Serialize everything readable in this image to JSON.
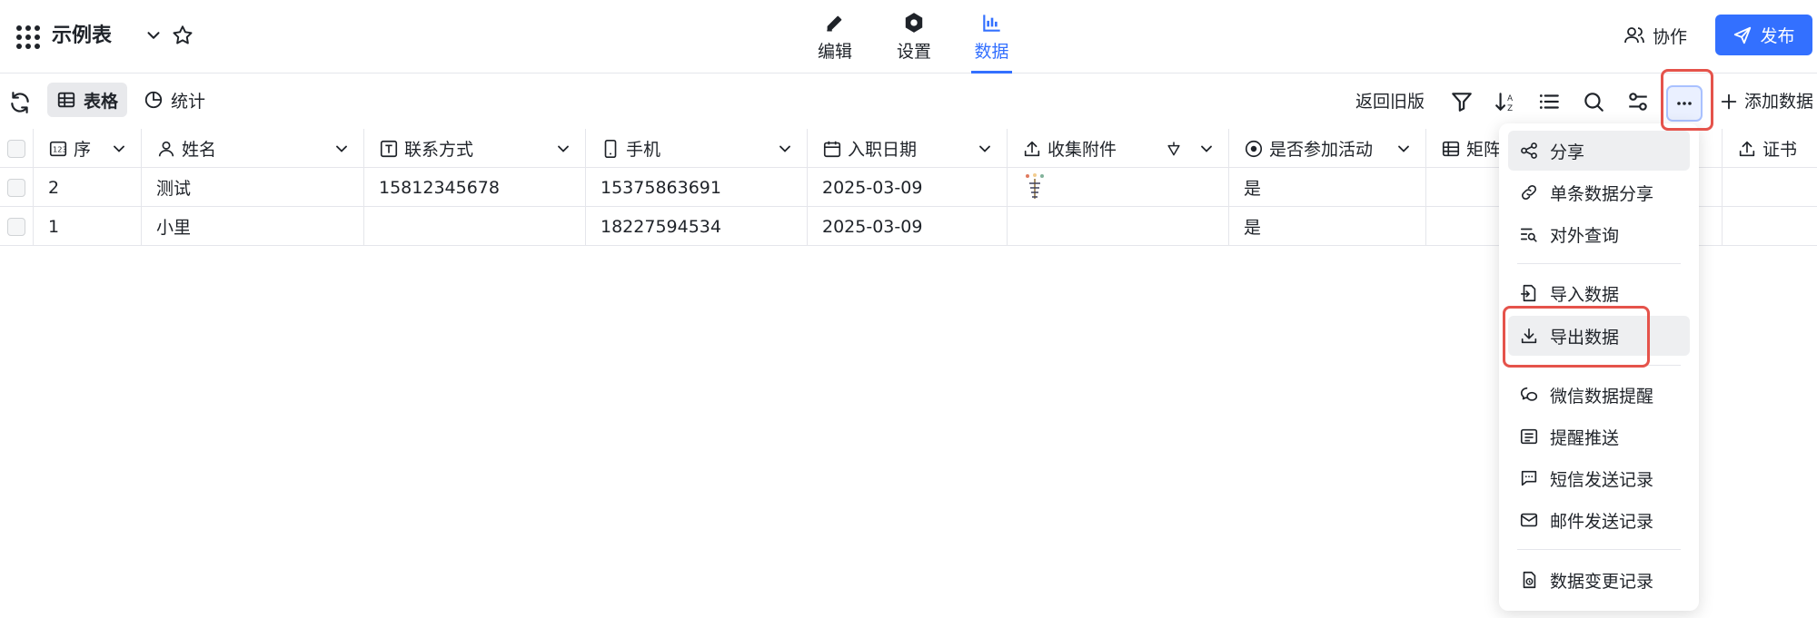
{
  "header": {
    "title": "示例表",
    "tabs": [
      {
        "label": "编辑",
        "icon": "pen-icon"
      },
      {
        "label": "设置",
        "icon": "hexagon-settings-icon"
      },
      {
        "label": "数据",
        "icon": "bar-chart-icon"
      }
    ],
    "active_tab": "数据",
    "collab_label": "协作",
    "publish_label": "发布"
  },
  "toolbar": {
    "views": [
      {
        "label": "表格",
        "icon": "table-icon"
      },
      {
        "label": "统计",
        "icon": "pie-chart-icon"
      }
    ],
    "old_version_label": "返回旧版",
    "add_data_label": "添加数据"
  },
  "table": {
    "columns": [
      {
        "label": "序",
        "icon": "number-icon"
      },
      {
        "label": "姓名",
        "icon": "person-icon"
      },
      {
        "label": "联系方式",
        "icon": "text-field-icon"
      },
      {
        "label": "手机",
        "icon": "phone-icon"
      },
      {
        "label": "入职日期",
        "icon": "calendar-icon"
      },
      {
        "label": "收集附件",
        "icon": "upload-icon"
      },
      {
        "label": "是否参加活动",
        "icon": "radio-icon"
      },
      {
        "label": "矩阵",
        "icon": "matrix-icon"
      },
      {
        "label": "证书",
        "icon": "upload-icon"
      }
    ],
    "rows": [
      {
        "seq": "2",
        "name": "测试",
        "contact": "15812345678",
        "phone": "15375863691",
        "date": "2025-03-09",
        "attend": "是"
      },
      {
        "seq": "1",
        "name": "小里",
        "contact": "",
        "phone": "18227594534",
        "date": "2025-03-09",
        "attend": "是"
      }
    ]
  },
  "menu": {
    "items": [
      {
        "label": "分享",
        "icon": "share-icon"
      },
      {
        "label": "单条数据分享",
        "icon": "link-icon"
      },
      {
        "label": "对外查询",
        "icon": "search-list-icon"
      },
      {
        "label": "导入数据",
        "icon": "import-icon"
      },
      {
        "label": "导出数据",
        "icon": "download-icon"
      },
      {
        "label": "微信数据提醒",
        "icon": "wechat-icon"
      },
      {
        "label": "提醒推送",
        "icon": "message-list-icon"
      },
      {
        "label": "短信发送记录",
        "icon": "sms-icon"
      },
      {
        "label": "邮件发送记录",
        "icon": "mail-icon"
      },
      {
        "label": "数据变更记录",
        "icon": "history-icon"
      }
    ]
  },
  "colors": {
    "accent": "#3370ff",
    "highlight_box": "#e5534b"
  }
}
